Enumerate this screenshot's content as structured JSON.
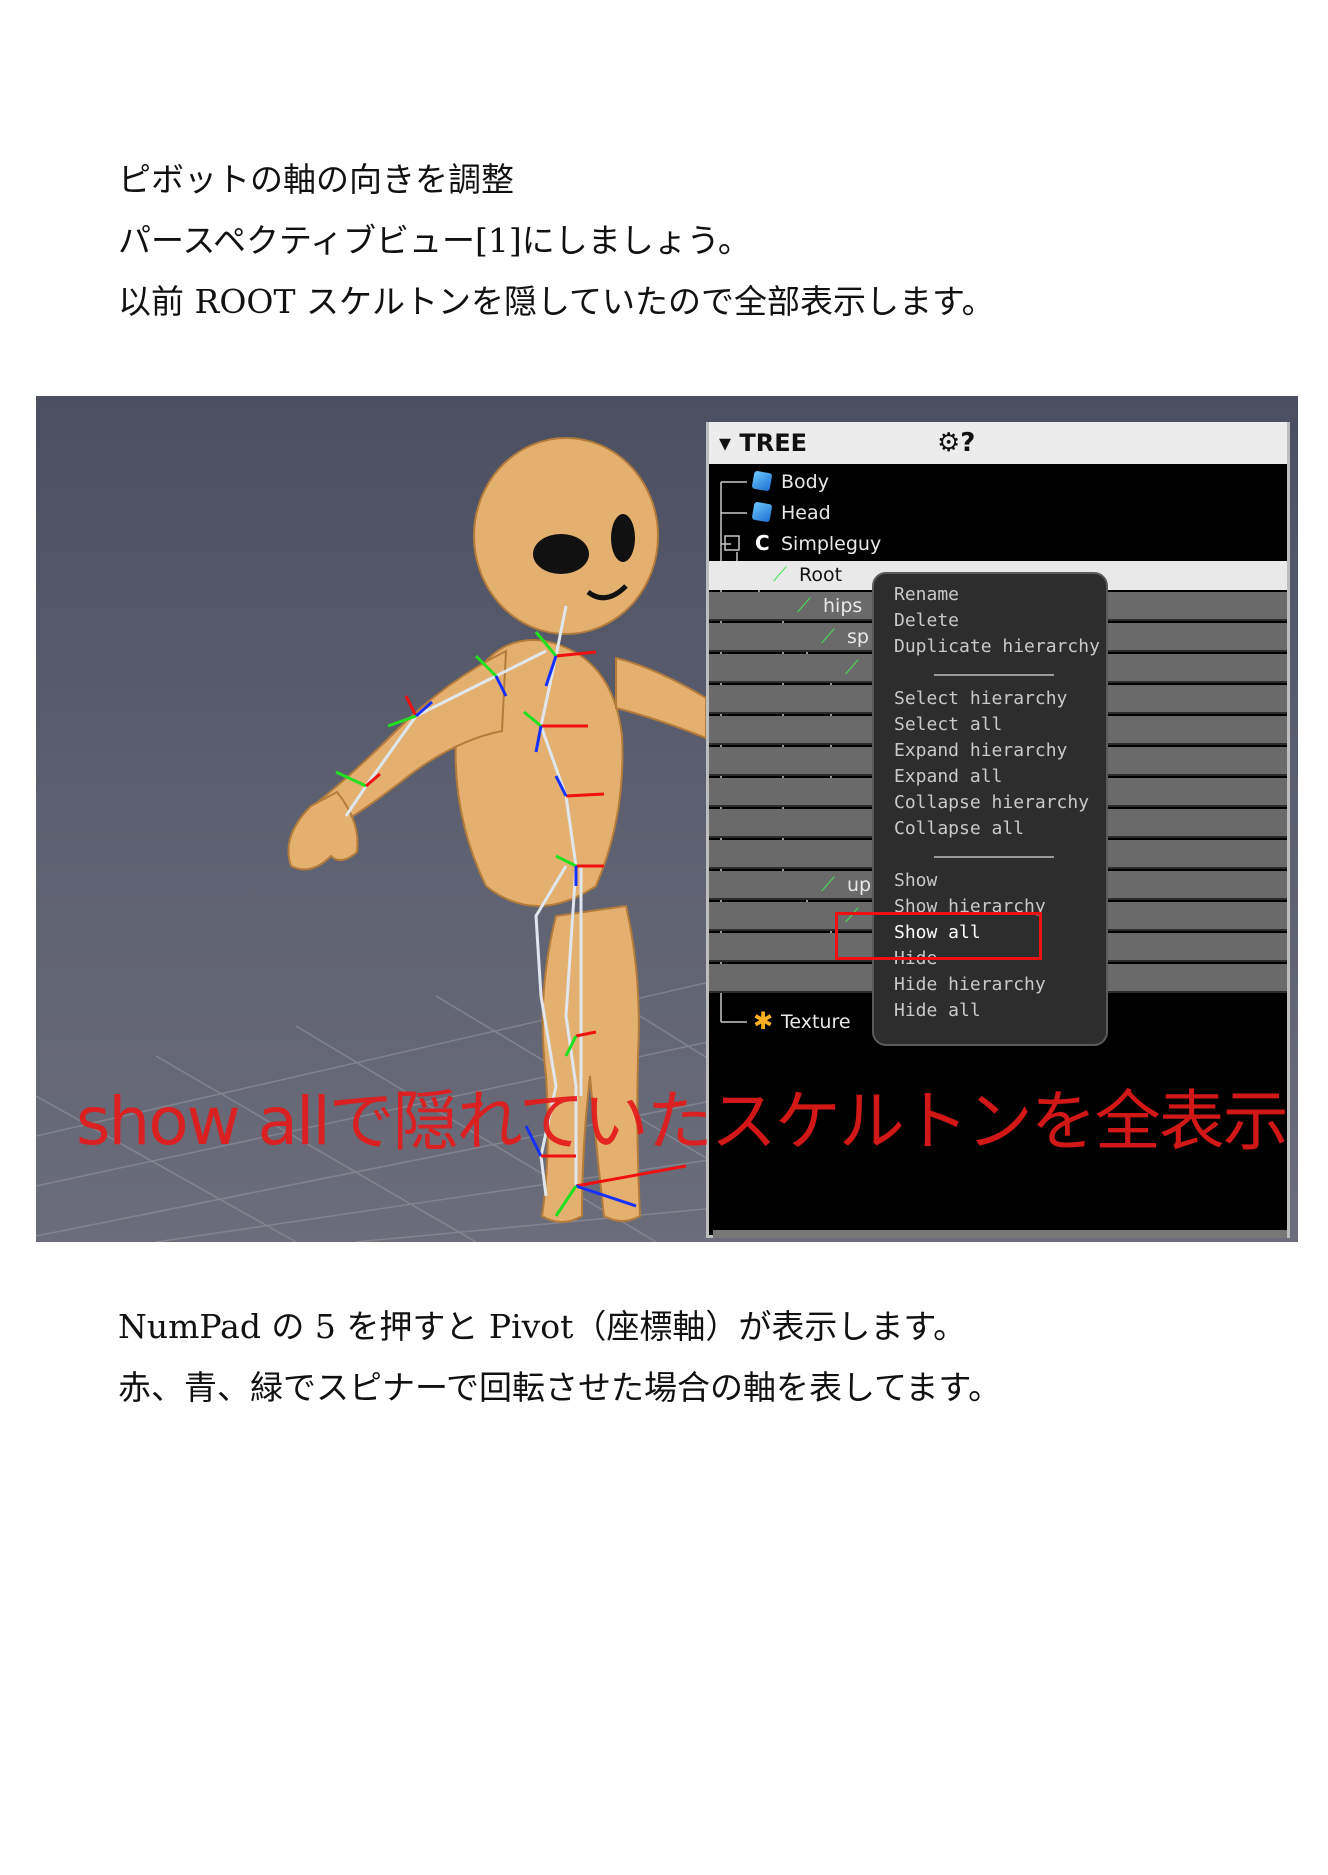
{
  "intro": {
    "line1": "ピボットの軸の向きを調整",
    "line2": "パースペクティブビュー[1]にしましょう。",
    "line3": "以前 ROOT スケルトンを隠していたので全部表示します。"
  },
  "screenshot": {
    "tree_panel": {
      "title": "▾ TREE",
      "header_icons": "⚙?",
      "rows": [
        {
          "label": "Body",
          "icon": "mesh-icon"
        },
        {
          "label": "Head",
          "icon": "mesh-icon"
        },
        {
          "label": "Simpleguy",
          "icon": "skeleton-icon"
        },
        {
          "label": "Root",
          "icon": "bone-icon"
        },
        {
          "label": "hips",
          "icon": "bone-icon"
        },
        {
          "label": "sp",
          "icon": "bone-icon"
        },
        {
          "label": "up",
          "icon": "bone-icon"
        },
        {
          "label": "Texture",
          "icon": "texture-icon"
        }
      ]
    },
    "context_menu": {
      "items": [
        "Rename",
        "Delete",
        "Duplicate hierarchy",
        "Select hierarchy",
        "Select all",
        "Expand hierarchy",
        "Expand all",
        "Collapse hierarchy",
        "Collapse all",
        "Show",
        "Show hierarchy",
        "Show all",
        "Hide",
        "Hide hierarchy",
        "Hide all"
      ],
      "highlighted_item": "Show all"
    },
    "overlay_caption": "show allで隠れていたスケルトンを全表示",
    "colors": {
      "highlight": "#e11111",
      "caption": "#e41a1a",
      "bone": "#46e05a"
    }
  },
  "outro": {
    "line1": "NumPad の 5 を押すと Pivot（座標軸）が表示します。",
    "line2": "赤、青、緑でスピナーで回転させた場合の軸を表してます。"
  }
}
